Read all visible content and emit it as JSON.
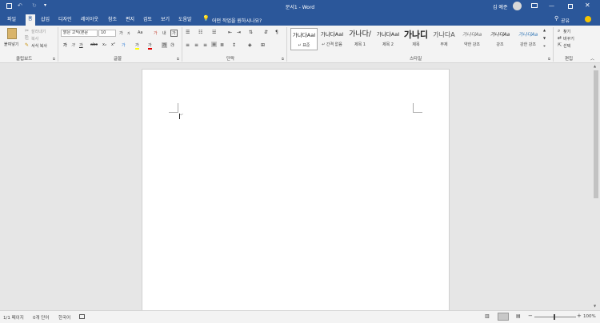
{
  "window": {
    "title": "문서1 - Word",
    "user": "김 예준"
  },
  "tabs": [
    "파일",
    "홈",
    "삽입",
    "디자인",
    "레이아웃",
    "참조",
    "편지",
    "검토",
    "보기",
    "도움말"
  ],
  "tell_me": "어떤 작업을 원하시나요?",
  "share_label": "공유",
  "clipboard": {
    "paste": "붙여넣기",
    "cut": "잘라내기",
    "copy": "복사",
    "format_painter": "서식 복사",
    "group": "클립보드"
  },
  "font": {
    "name": "맑은 고딕(본문",
    "size": "10",
    "group": "글꼴",
    "grow": "가",
    "shrink": "가",
    "case": "Aa",
    "clear": "가",
    "phonetic": "내",
    "border": "가",
    "bold": "가",
    "italic": "가",
    "underline": "가",
    "strike": "abc",
    "sub": "x₂",
    "sup": "x²",
    "effects": "가",
    "highlight": "가",
    "color": "가",
    "shade": "가",
    "enclose": "㉮"
  },
  "paragraph": {
    "group": "단락"
  },
  "styles": {
    "group": "스타일",
    "items": [
      {
        "sample": "가나다AaI",
        "name": "↵ 표준"
      },
      {
        "sample": "가나다AaI",
        "name": "↵ 간격 없음"
      },
      {
        "sample": "가나다/",
        "name": "제목 1"
      },
      {
        "sample": "가나다AaI",
        "name": "제목 2"
      },
      {
        "sample": "가나디",
        "name": "제목"
      },
      {
        "sample": "가나다A",
        "name": "부제"
      },
      {
        "sample": "가나다Aa",
        "name": "약한 강조"
      },
      {
        "sample": "가나다Aa",
        "name": "강조"
      },
      {
        "sample": "가나다Aa",
        "name": "강한 강조"
      }
    ]
  },
  "editing": {
    "find": "찾기",
    "replace": "바꾸기",
    "select": "선택",
    "group": "편집"
  },
  "status": {
    "page": "1/1 페이지",
    "words": "0개 단어",
    "language": "한국어",
    "zoom": "100%"
  },
  "colors": {
    "accent": "#2b579a",
    "ribbon": "#f3f3f3",
    "canvas": "#e6e6e6"
  }
}
